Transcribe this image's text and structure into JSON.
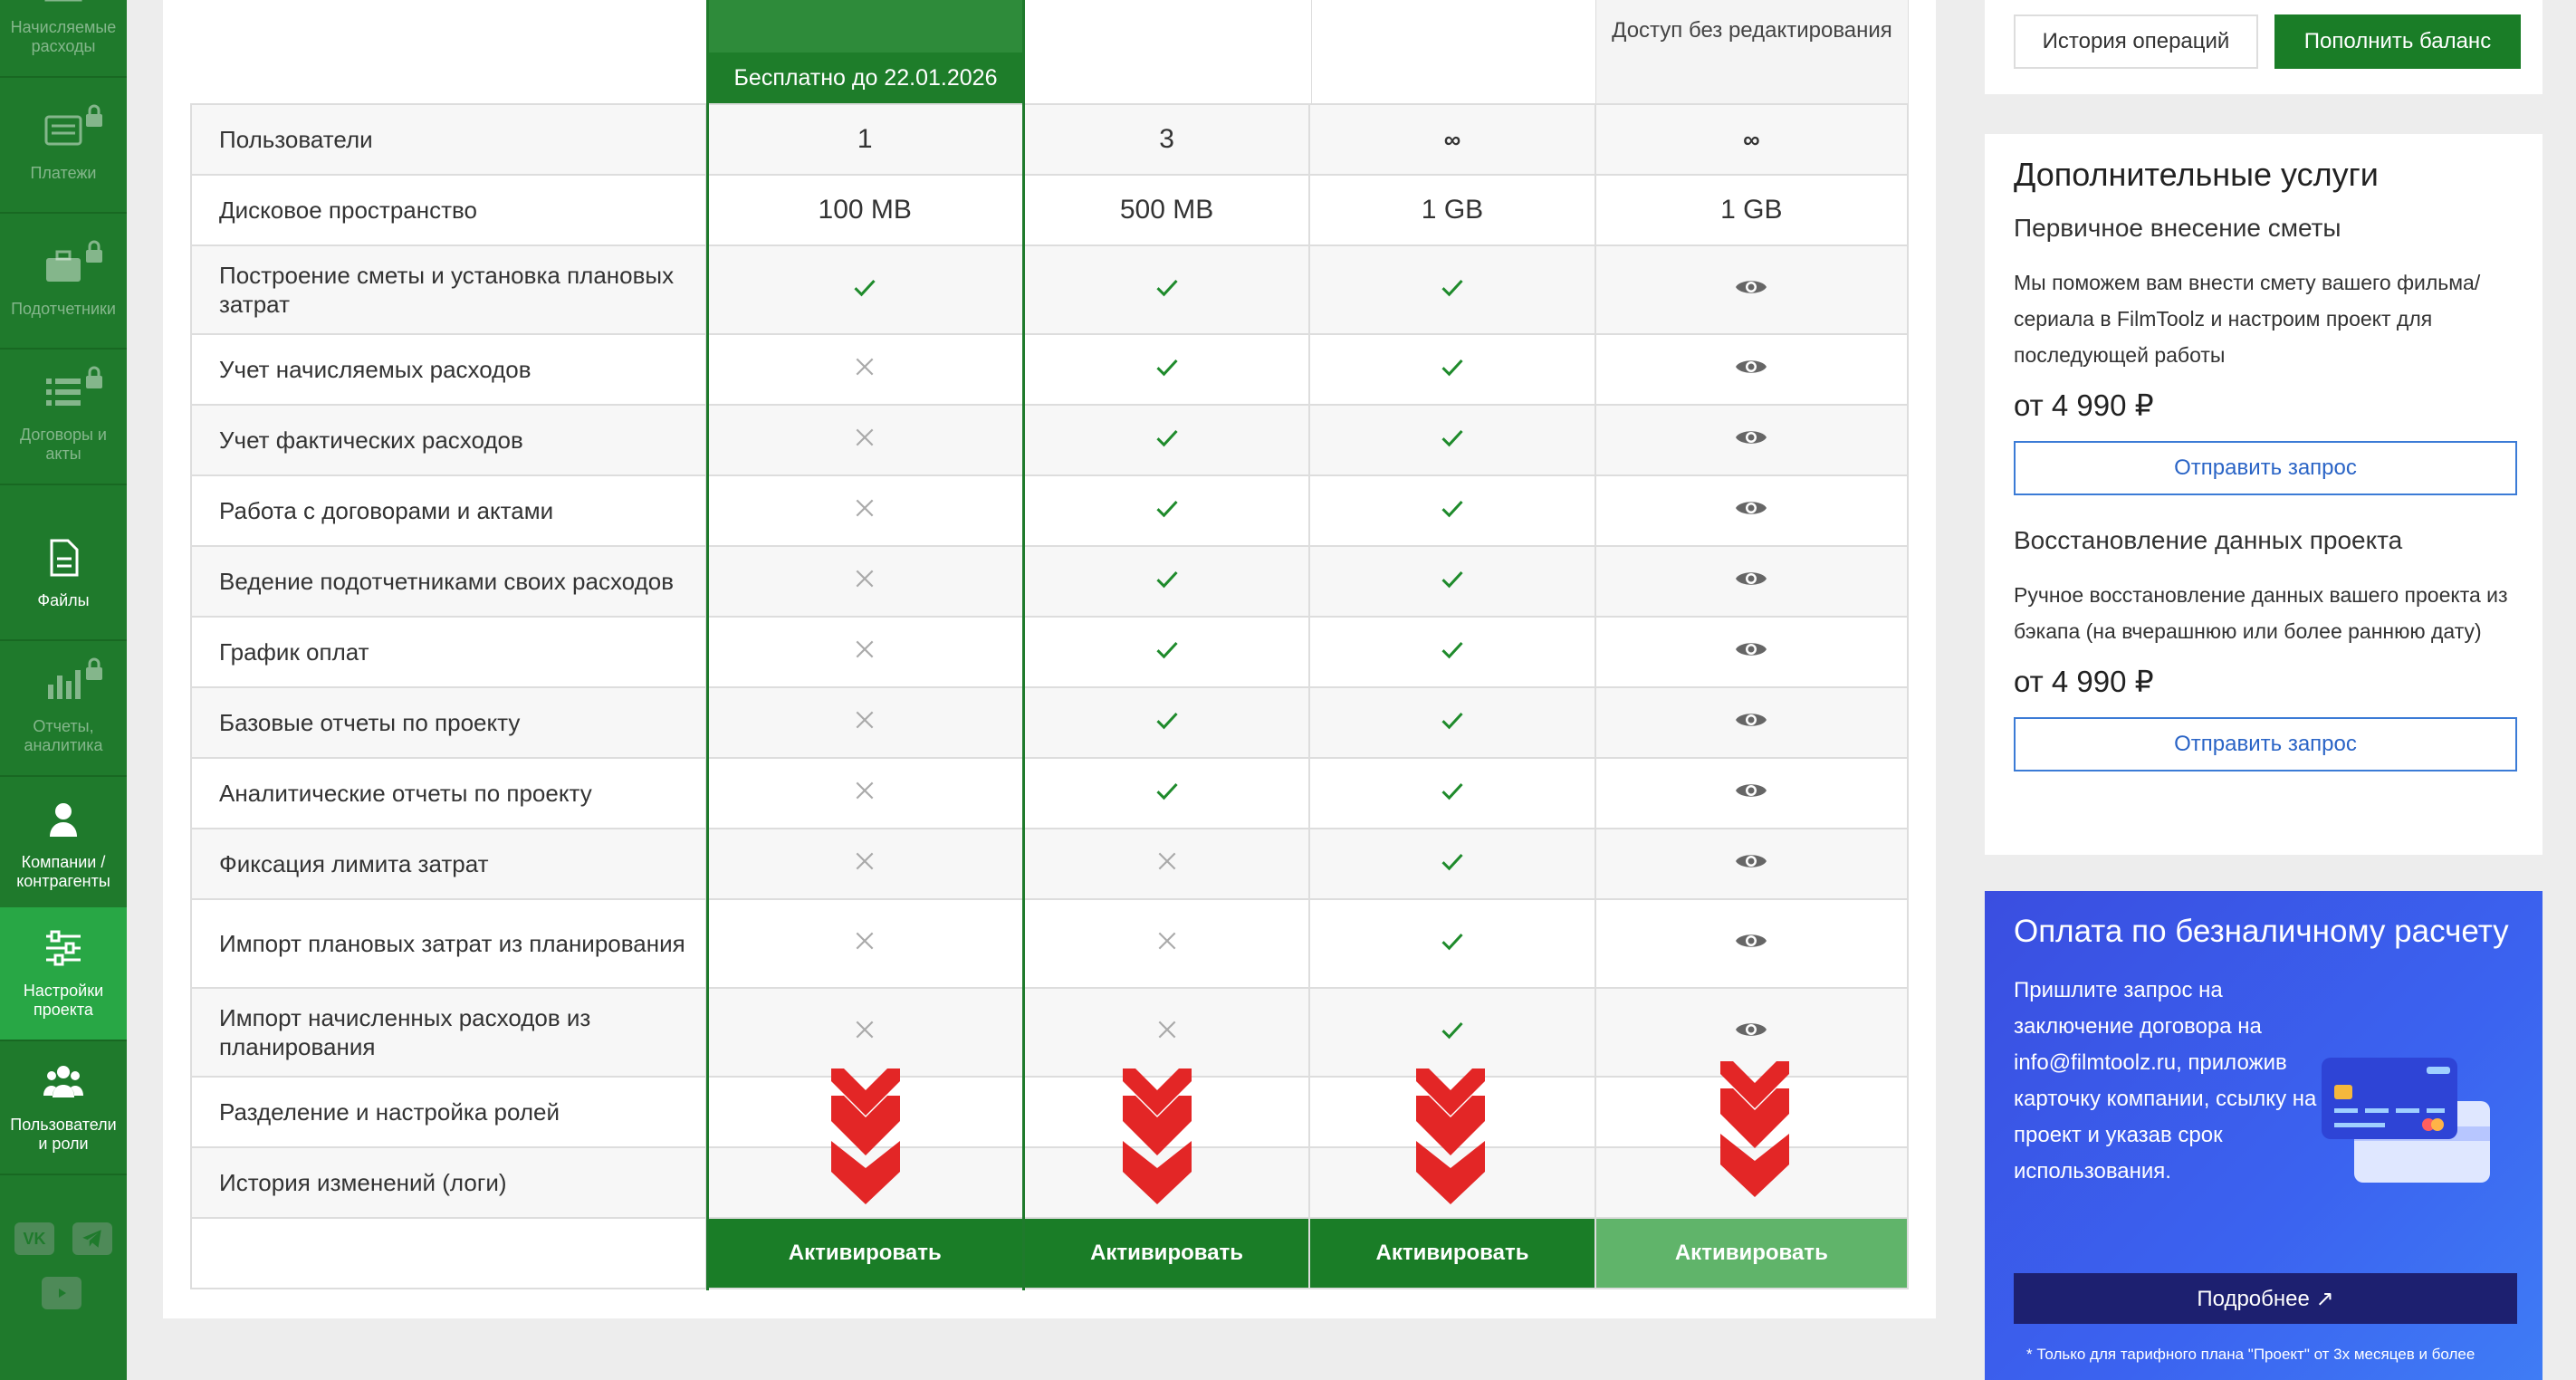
{
  "sidebar": {
    "items": [
      {
        "label": "Начисляемые расходы",
        "icon": "table-icon",
        "locked": true
      },
      {
        "label": "Платежи",
        "icon": "payments-icon",
        "locked": true
      },
      {
        "label": "Подотчетники",
        "icon": "briefcase-icon",
        "locked": true
      },
      {
        "label": "Договоры и акты",
        "icon": "list-icon",
        "locked": true
      },
      {
        "label": "Файлы",
        "icon": "file-icon",
        "locked": false
      },
      {
        "label": "Отчеты, аналитика",
        "icon": "bar-chart-icon",
        "locked": true
      },
      {
        "label": "Компании / контрагенты",
        "icon": "user-icon",
        "locked": false
      },
      {
        "label": "Настройки проекта",
        "icon": "sliders-icon",
        "locked": false,
        "active": true
      },
      {
        "label": "Пользователи и роли",
        "icon": "users-icon",
        "locked": false
      }
    ],
    "social": [
      "vk-icon",
      "telegram-icon",
      "youtube-icon"
    ]
  },
  "plans": {
    "free_band": "Бесплатно до 22.01.2026",
    "readonly_head": "Доступ без редактирования",
    "activate": "Активировать",
    "rows": [
      {
        "feature": "Пользователи",
        "values": [
          "1",
          "3",
          "∞",
          "∞"
        ]
      },
      {
        "feature": "Дисковое пространство",
        "values": [
          "100 MB",
          "500 MB",
          "1 GB",
          "1 GB"
        ]
      },
      {
        "feature": "Построение сметы и установка плановых затрат",
        "values": [
          "check",
          "check",
          "check",
          "eye"
        ]
      },
      {
        "feature": "Учет начисляемых расходов",
        "values": [
          "cross",
          "check",
          "check",
          "eye"
        ]
      },
      {
        "feature": "Учет фактических расходов",
        "values": [
          "cross",
          "check",
          "check",
          "eye"
        ]
      },
      {
        "feature": "Работа с договорами и актами",
        "values": [
          "cross",
          "check",
          "check",
          "eye"
        ]
      },
      {
        "feature": "Ведение подотчетниками своих расходов",
        "values": [
          "cross",
          "check",
          "check",
          "eye"
        ]
      },
      {
        "feature": "График оплат",
        "values": [
          "cross",
          "check",
          "check",
          "eye"
        ]
      },
      {
        "feature": "Базовые отчеты по проекту",
        "values": [
          "cross",
          "check",
          "check",
          "eye"
        ]
      },
      {
        "feature": "Аналитические отчеты по проекту",
        "values": [
          "cross",
          "check",
          "check",
          "eye"
        ]
      },
      {
        "feature": "Фиксация лимита затрат",
        "values": [
          "cross",
          "cross",
          "check",
          "eye"
        ]
      },
      {
        "feature": "Импорт плановых затрат из планирования",
        "values": [
          "cross",
          "cross",
          "check",
          "eye"
        ]
      },
      {
        "feature": "Импорт начисленных расходов из планирования",
        "values": [
          "cross",
          "cross",
          "check",
          "eye"
        ]
      },
      {
        "feature": "Разделение и настройка ролей",
        "values": [
          "",
          "",
          "",
          ""
        ]
      },
      {
        "feature": "История изменений (логи)",
        "values": [
          "",
          "",
          "",
          ""
        ]
      }
    ]
  },
  "top_buttons": {
    "history": "История операций",
    "topup": "Пополнить баланс"
  },
  "services": {
    "title": "Дополнительные услуги",
    "items": [
      {
        "heading": "Первичное внесение сметы",
        "text": "Мы поможем вам внести смету вашего фильма/сериала в FilmToolz и настроим проект для последующей работы",
        "price": "от 4 990 ₽",
        "button": "Отправить запрос"
      },
      {
        "heading": "Восстановление данных проекта",
        "text": "Ручное восстановление данных вашего проекта из бэкапа (на вчерашнюю или более раннюю дату)",
        "price": "от 4 990 ₽",
        "button": "Отправить запрос"
      }
    ]
  },
  "cashless": {
    "title": "Оплата по безналичному расчету",
    "text": "Пришлите запрос на заключение договора на info@filmtoolz.ru, приложив карточку компании, ссылку на проект и указав срок использования.",
    "button": "Подробнее ↗",
    "note": "* Только для тарифного плана \"Проект\" от 3х месяцев и более"
  },
  "colors": {
    "sidebar": "#1f7a2c",
    "active": "#28a745",
    "check": "#1f8b2c",
    "chevron": "#e32626",
    "cashless": "#3b5bed"
  }
}
